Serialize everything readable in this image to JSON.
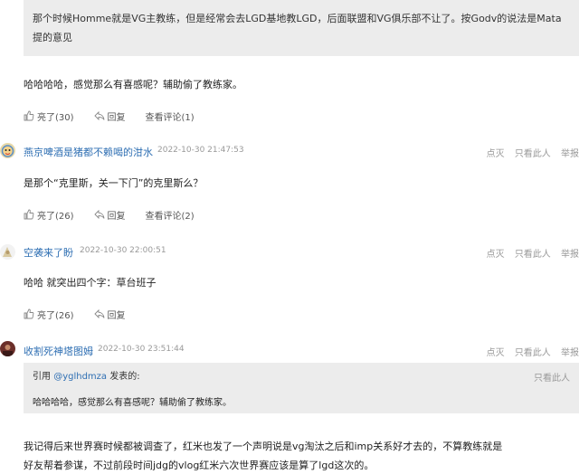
{
  "top_quote": {
    "text": "那个时候Homme就是VG主教练，但是经常会去LGD基地教LGD，后面联盟和VG俱乐部不让了。按Godv的说法是Mata提的意见"
  },
  "post1": {
    "text": "哈哈哈哈，感觉那么有喜感呢？辅助偷了教练家。",
    "actions": {
      "like": "亮了(30)",
      "reply": "回复",
      "view": "查看评论(1)"
    }
  },
  "post2": {
    "username": "燕京啤酒是猪都不赖喝的泔水",
    "time": "2022-10-30 21:47:53",
    "right": {
      "dislike": "点灭",
      "only": "只看此人",
      "report": "举报"
    },
    "text": "是那个“克里斯，关一下门”的克里斯么？",
    "actions": {
      "like": "亮了(26)",
      "reply": "回复",
      "view": "查看评论(2)"
    }
  },
  "post3": {
    "username": "空袭来了盼",
    "time": "2022-10-30 22:00:51",
    "right": {
      "dislike": "点灭",
      "only": "只看此人",
      "report": "举报"
    },
    "text": "哈哈 就突出四个字：草台班子",
    "actions": {
      "like": "亮了(26)",
      "reply": "回复"
    }
  },
  "post4": {
    "username": "收割死神塔图姆",
    "time": "2022-10-30 23:51:44",
    "right": {
      "dislike": "点灭",
      "only": "只看此人",
      "report": "举报"
    },
    "quote": {
      "prefix": "引用",
      "user": "@yglhdmza",
      "suffix": "发表的:",
      "text": "哈哈哈哈，感觉那么有喜感呢？辅助偷了教练家。",
      "only": "只看此人"
    },
    "text_line1": "我记得后来世界赛时候都被调查了，红米也发了一个声明说是vg淘汰之后和imp关系好才去的，不算教练就是",
    "text_line2": "好友帮着参谋，不过前段时间jdg的vlog红米六次世界赛应该是算了lgd这次的。"
  }
}
